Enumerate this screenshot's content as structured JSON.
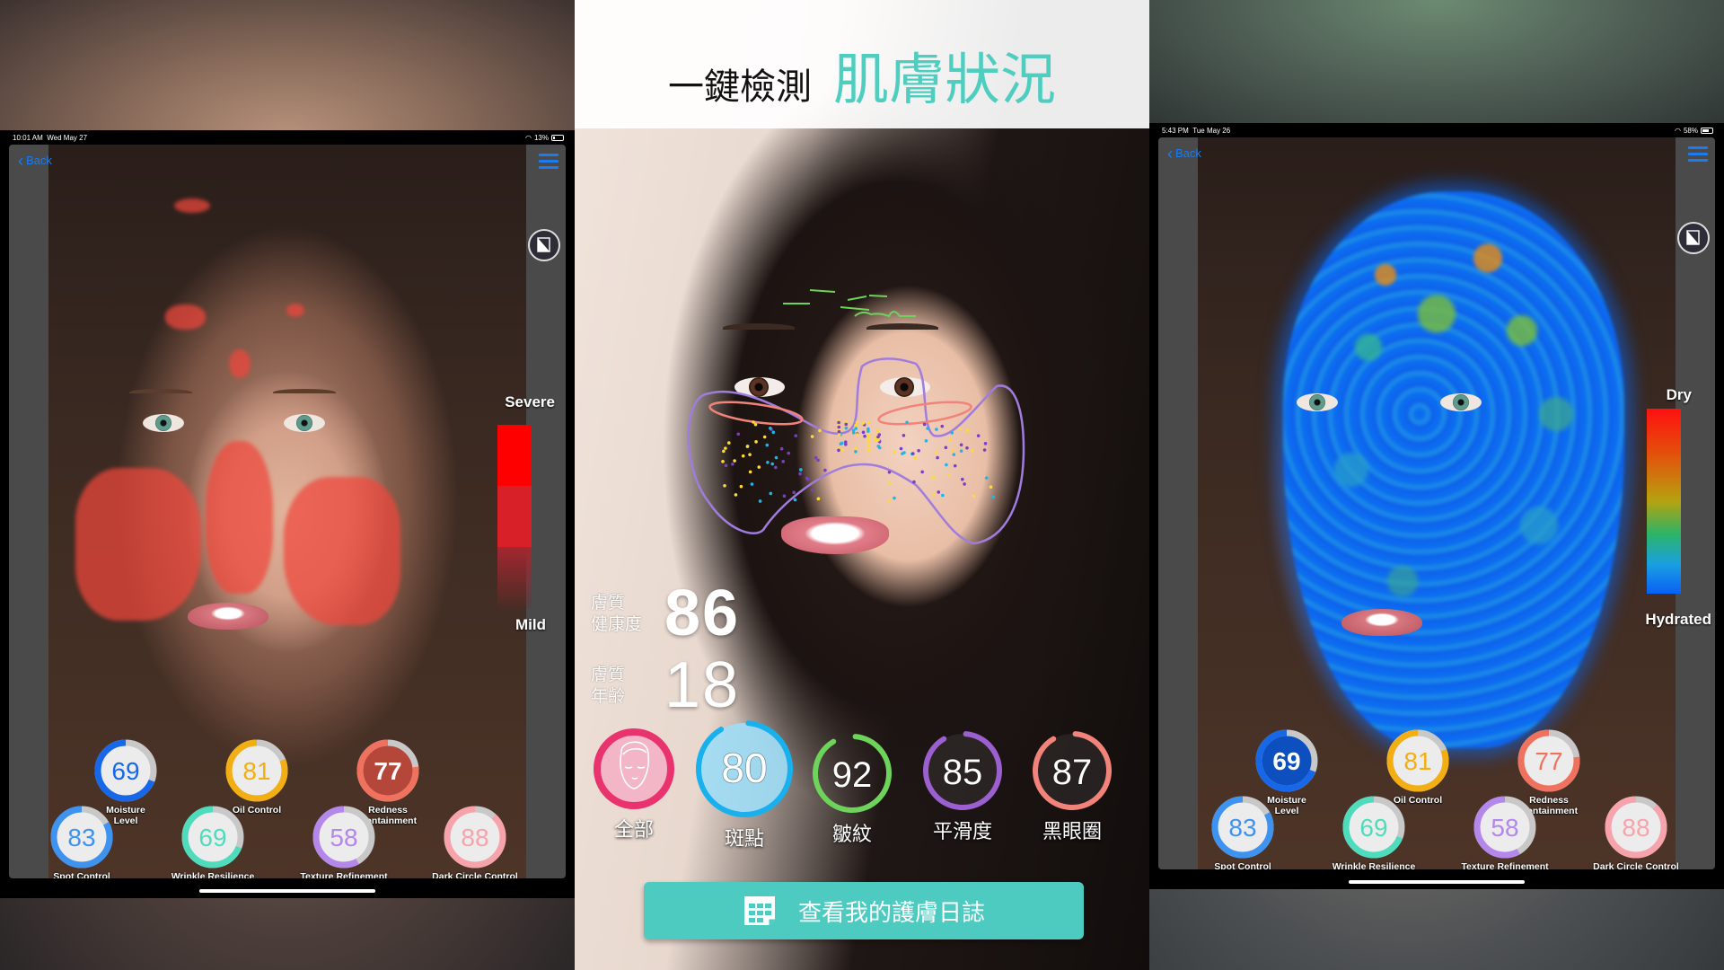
{
  "left": {
    "status_time": "10:01 AM",
    "status_date": "Wed May 27",
    "battery": "13%",
    "battery_fraction": 0.13,
    "back_label": "Back",
    "legend_top": "Severe",
    "legend_bottom": "Mild",
    "legend_colors": [
      "#ff0000",
      "#e0202a",
      "#8a2d30"
    ],
    "scores": [
      {
        "label": "Moisture Level",
        "value": "69",
        "color": "#1768e8",
        "filled": false
      },
      {
        "label": "Oil Control",
        "value": "81",
        "color": "#f2ae13",
        "filled": false
      },
      {
        "label": "Redness Containment",
        "value": "77",
        "color": "#f0725e",
        "filled": true,
        "fill": "#b4463a"
      },
      {
        "label": "Spot Control",
        "value": "83",
        "color": "#3f93f0",
        "filled": false
      },
      {
        "label": "Wrinkle Resilience",
        "value": "69",
        "color": "#4fdcbd",
        "filled": false
      },
      {
        "label": "Texture Refinement",
        "value": "58",
        "color": "#b487ea",
        "filled": false
      },
      {
        "label": "Dark Circle Control",
        "value": "88",
        "color": "#f7a3ab",
        "filled": false
      }
    ]
  },
  "center": {
    "headline_dark": "一鍵檢測",
    "headline_teal": "肌膚狀況",
    "health_label": "膚質\n健康度",
    "health_value": "86",
    "age_label": "膚質\n年齡",
    "age_value": "18",
    "rings": [
      {
        "label": "全部",
        "value": "",
        "icon": "face-icon",
        "color": "#e8336e",
        "fill": "rgba(245,170,195,0.75)"
      },
      {
        "label": "斑點",
        "value": "80",
        "color": "#19b0ee",
        "fill": "rgba(160,220,245,0.92)"
      },
      {
        "label": "皺紋",
        "value": "92",
        "color": "#6ed35a",
        "fill": "rgba(0,0,0,0)"
      },
      {
        "label": "平滑度",
        "value": "85",
        "color": "#9b5fcf",
        "fill": "rgba(60,55,55,0.45)"
      },
      {
        "label": "黑眼圈",
        "value": "87",
        "color": "#f2837a",
        "fill": "rgba(60,55,55,0.45)"
      }
    ],
    "diary_button": "查看我的護膚日誌"
  },
  "right": {
    "status_time": "5:43 PM",
    "status_date": "Tue May 26",
    "battery": "58%",
    "battery_fraction": 0.58,
    "back_label": "Back",
    "legend_top": "Dry",
    "legend_bottom": "Hydrated",
    "scores": [
      {
        "label": "Moisture Level",
        "value": "69",
        "color": "#1768e8",
        "filled": true,
        "fill": "#0d4fbf"
      },
      {
        "label": "Oil Control",
        "value": "81",
        "color": "#f2ae13",
        "filled": false
      },
      {
        "label": "Redness Containment",
        "value": "77",
        "color": "#f0725e",
        "filled": false
      },
      {
        "label": "Spot Control",
        "value": "83",
        "color": "#3f93f0",
        "filled": false
      },
      {
        "label": "Wrinkle Resilience",
        "value": "69",
        "color": "#4fdcbd",
        "filled": false
      },
      {
        "label": "Texture Refinement",
        "value": "58",
        "color": "#b487ea",
        "filled": false
      },
      {
        "label": "Dark Circle Control",
        "value": "88",
        "color": "#f7a3ab",
        "filled": false
      }
    ]
  }
}
